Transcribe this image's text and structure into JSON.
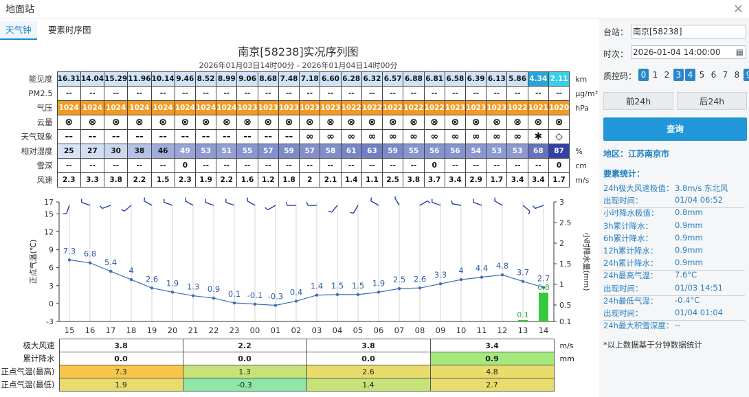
{
  "window": {
    "title": "地面站",
    "close": "×"
  },
  "tabs": [
    {
      "label": "天气钟"
    },
    {
      "label": "要素时序图"
    }
  ],
  "chart": {
    "title": "南京[58238]实况序列图",
    "subtitle": "2026年01月03日14时00分 - 2026年01月04日14时00分"
  },
  "obs_rows": [
    {
      "label": "能见度",
      "unit": "km",
      "values": [
        "16.31",
        "14.04",
        "15.29",
        "11.96",
        "10.14",
        "9.46",
        "8.52",
        "8.99",
        "9.06",
        "8.68",
        "7.48",
        "7.18",
        "6.60",
        "6.28",
        "6.32",
        "6.57",
        "6.88",
        "6.81",
        "6.58",
        "6.39",
        "6.13",
        "5.86",
        "4.34",
        "2.11"
      ]
    },
    {
      "label": "PM2.5",
      "unit": "μg/m³",
      "values": [
        "--",
        "--",
        "--",
        "--",
        "--",
        "--",
        "--",
        "--",
        "--",
        "--",
        "--",
        "--",
        "--",
        "--",
        "--",
        "--",
        "--",
        "--",
        "--",
        "--",
        "--",
        "--",
        "--",
        "--"
      ]
    },
    {
      "label": "气压",
      "unit": "hPa",
      "values": [
        "1024",
        "1024",
        "1024",
        "1024",
        "1024",
        "1024",
        "1024",
        "1024",
        "1023",
        "1023",
        "1023",
        "1023",
        "1023",
        "1022",
        "1022",
        "1022",
        "1022",
        "1022",
        "1023",
        "1023",
        "1023",
        "1022",
        "1021",
        "1020"
      ]
    },
    {
      "label": "云量",
      "unit": "",
      "values": [
        "⊗",
        "⊗",
        "⊗",
        "⊗",
        "⊗",
        "⊗",
        "⊗",
        "⊗",
        "⊗",
        "⊗",
        "⊗",
        "⊗",
        "⊗",
        "⊗",
        "⊗",
        "⊗",
        "⊗",
        "⊗",
        "⊗",
        "⊗",
        "⊗",
        "⊗",
        "⊗",
        "⊗"
      ]
    },
    {
      "label": "天气现象",
      "unit": "",
      "values": [
        "--",
        "--",
        "--",
        "--",
        "--",
        "--",
        "--",
        "--",
        "--",
        "--",
        "--",
        "∞",
        "∞",
        "∞",
        "∞",
        "∞",
        "∞",
        "∞",
        "∞",
        "∞",
        "∞",
        "∞",
        "✱",
        "◇"
      ]
    },
    {
      "label": "相对湿度",
      "unit": "%",
      "values": [
        "25",
        "27",
        "30",
        "38",
        "46",
        "49",
        "53",
        "51",
        "55",
        "57",
        "59",
        "57",
        "58",
        "61",
        "63",
        "59",
        "55",
        "56",
        "56",
        "54",
        "53",
        "53",
        "68",
        "87"
      ]
    },
    {
      "label": "雪深",
      "unit": "cm",
      "values": [
        "--",
        "--",
        "--",
        "--",
        "--",
        "0",
        "--",
        "--",
        "--",
        "--",
        "--",
        "--",
        "--",
        "--",
        "--",
        "--",
        "--",
        "0",
        "--",
        "--",
        "--",
        "--",
        "--",
        "0"
      ]
    },
    {
      "label": "风速",
      "unit": "m/s",
      "values": [
        "2.3",
        "3.3",
        "3.8",
        "2.2",
        "1.5",
        "2.3",
        "1.9",
        "2.2",
        "1.6",
        "1.2",
        "1.8",
        "2",
        "2.1",
        "1.4",
        "1.1",
        "2.5",
        "3.8",
        "3.7",
        "3.4",
        "2.9",
        "1.7",
        "3.4",
        "3.4",
        "1.7"
      ]
    }
  ],
  "colors": {
    "vis_default": "#cfe3f7",
    "vis_low": "#2aa3d6",
    "vis_very_low": "#33d0ea",
    "pressure": "#f39a24",
    "humidity_low": "#d7e4f6",
    "humidity_high": "#3340a3",
    "temp_line": "#3a6fb5",
    "precip_bar": "#37c93d",
    "sum_green": "#a5e87b",
    "sum_orange": "#f7c54b",
    "sum_yellow": "#e9dc6d",
    "sum_lime": "#c8e27a",
    "sum_teal": "#8fe6a5"
  },
  "chart_data": {
    "type": "line",
    "x": [
      "15",
      "16",
      "17",
      "18",
      "19",
      "20",
      "21",
      "22",
      "23",
      "00",
      "01",
      "02",
      "03",
      "04",
      "05",
      "06",
      "07",
      "08",
      "09",
      "10",
      "11",
      "12",
      "13",
      "14"
    ],
    "series": [],
    "temperature": [
      7.3,
      6.8,
      5.4,
      4,
      2.6,
      1.9,
      1.3,
      0.9,
      0.1,
      -0.1,
      -0.3,
      0.4,
      1.4,
      1.5,
      1.5,
      1.9,
      2.5,
      2.6,
      3.3,
      4,
      4.4,
      4.8,
      3.7,
      2.7
    ],
    "precipitation": [
      0,
      0,
      0,
      0,
      0,
      0,
      0,
      0,
      0,
      0,
      0,
      0,
      0,
      0,
      0,
      0,
      0,
      0,
      0,
      0,
      0,
      0,
      0.1,
      0.8
    ],
    "wind_dir_deg": [
      200,
      290,
      250,
      230,
      300,
      290,
      300,
      290,
      290,
      300,
      240,
      270,
      270,
      220,
      210,
      300,
      330,
      60,
      290,
      280,
      290,
      300,
      130,
      250
    ],
    "ylabel_left": "正点气温(℃)",
    "ylabel_right": "小时降水量(mm)",
    "ylim_left": [
      -3,
      17
    ],
    "yticks_left": [
      "17",
      "15",
      "12",
      "9",
      "6",
      "3",
      "0",
      "-3"
    ],
    "ylim_right": [
      0.1,
      3
    ],
    "yticks_right": [
      "3",
      "2.5",
      "2",
      "1.5",
      "1",
      "0.5",
      "0.1"
    ]
  },
  "summary": {
    "rows": [
      {
        "label": "极大风速",
        "unit": "m/s",
        "values": [
          "3.8",
          "2.2",
          "3.8",
          "3.4"
        ]
      },
      {
        "label": "累计降水",
        "unit": "mm",
        "values": [
          "0.0",
          "0.0",
          "0.0",
          "0.9"
        ]
      },
      {
        "label": "正点气温(最高)",
        "unit": "",
        "values": [
          "7.3",
          "1.3",
          "2.6",
          "4.8"
        ]
      },
      {
        "label": "正点气温(最低)",
        "unit": "",
        "values": [
          "1.9",
          "-0.3",
          "1.4",
          "2.7"
        ]
      }
    ]
  },
  "side": {
    "station_label": "台站：",
    "station_value": "南京[58238]",
    "time_label": "时次：",
    "time_value": "2026-01-04 14:00:00",
    "qc_label": "质控码：",
    "qc_codes": [
      "0",
      "1",
      "2",
      "3",
      "4",
      "5",
      "6",
      "7",
      "8",
      "9"
    ],
    "qc_active": [
      true,
      false,
      false,
      true,
      true,
      false,
      false,
      false,
      false,
      true
    ],
    "prev_label": "前24h",
    "next_label": "后24h",
    "query_label": "查询",
    "region": "地区：江苏南京市",
    "stats_title": "要素统计：",
    "stats": [
      {
        "k": "24h极大风速极值：",
        "v": "3.8m/s 东北风"
      },
      {
        "k": "出现时间：",
        "v": "01/04 06:52"
      },
      {
        "k": "小时降水极值：",
        "v": "0.8mm"
      },
      {
        "k": "3h累计降水：",
        "v": "0.9mm"
      },
      {
        "k": "6h累计降水：",
        "v": "0.9mm"
      },
      {
        "k": "12h累计降水：",
        "v": "0.9mm"
      },
      {
        "k": "24h累计降水：",
        "v": "0.9mm"
      },
      {
        "k": "24h最高气温：",
        "v": "7.6°C"
      },
      {
        "k": "出现时间：",
        "v": "01/03 14:51"
      },
      {
        "k": "24h最低气温：",
        "v": "-0.4°C"
      },
      {
        "k": "出现时间：",
        "v": "01/04 01:04"
      },
      {
        "k": "24h最大积雪深度：",
        "v": "--"
      }
    ],
    "note": "*以上数据基于分钟数据统计"
  }
}
